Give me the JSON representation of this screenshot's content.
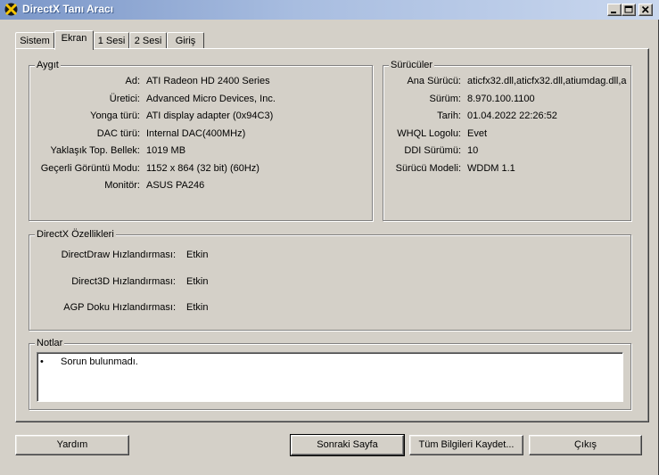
{
  "window": {
    "title": "DirectX Tanı Aracı"
  },
  "tabs": [
    {
      "label": "Sistem"
    },
    {
      "label": "Ekran"
    },
    {
      "label": "1 Sesi"
    },
    {
      "label": "2 Sesi"
    },
    {
      "label": "Giriş"
    }
  ],
  "device": {
    "title": "Aygıt",
    "rows": [
      {
        "label": "Ad:",
        "value": "ATI Radeon HD 2400 Series"
      },
      {
        "label": "Üretici:",
        "value": "Advanced Micro Devices, Inc."
      },
      {
        "label": "Yonga türü:",
        "value": "ATI display adapter (0x94C3)"
      },
      {
        "label": "DAC türü:",
        "value": "Internal DAC(400MHz)"
      },
      {
        "label": "Yaklaşık Top. Bellek:",
        "value": "1019 MB"
      },
      {
        "label": "Geçerli Görüntü Modu:",
        "value": "1152 x 864 (32 bit) (60Hz)"
      },
      {
        "label": "Monitör:",
        "value": "ASUS PA246"
      }
    ]
  },
  "drivers": {
    "title": "Sürücüler",
    "rows": [
      {
        "label": "Ana Sürücü:",
        "value": "aticfx32.dll,aticfx32.dll,atiumdag.dll,a"
      },
      {
        "label": "Sürüm:",
        "value": "8.970.100.1100"
      },
      {
        "label": "Tarih:",
        "value": "01.04.2022 22:26:52"
      },
      {
        "label": "WHQL Logolu:",
        "value": "Evet"
      },
      {
        "label": "DDI Sürümü:",
        "value": "10"
      },
      {
        "label": "Sürücü Modeli:",
        "value": "WDDM 1.1"
      }
    ]
  },
  "features": {
    "title": "DirectX Özellikleri",
    "rows": [
      {
        "label": "DirectDraw Hızlandırması:",
        "value": "Etkin"
      },
      {
        "label": "Direct3D Hızlandırması:",
        "value": "Etkin"
      },
      {
        "label": "AGP Doku Hızlandırması:",
        "value": "Etkin"
      }
    ]
  },
  "notes": {
    "title": "Notlar",
    "bullet": "•",
    "items": [
      "Sorun bulunmadı."
    ]
  },
  "buttons": {
    "help": "Yardım",
    "next_page": "Sonraki Sayfa",
    "save_all": "Tüm Bilgileri Kaydet...",
    "exit": "Çıkış"
  }
}
